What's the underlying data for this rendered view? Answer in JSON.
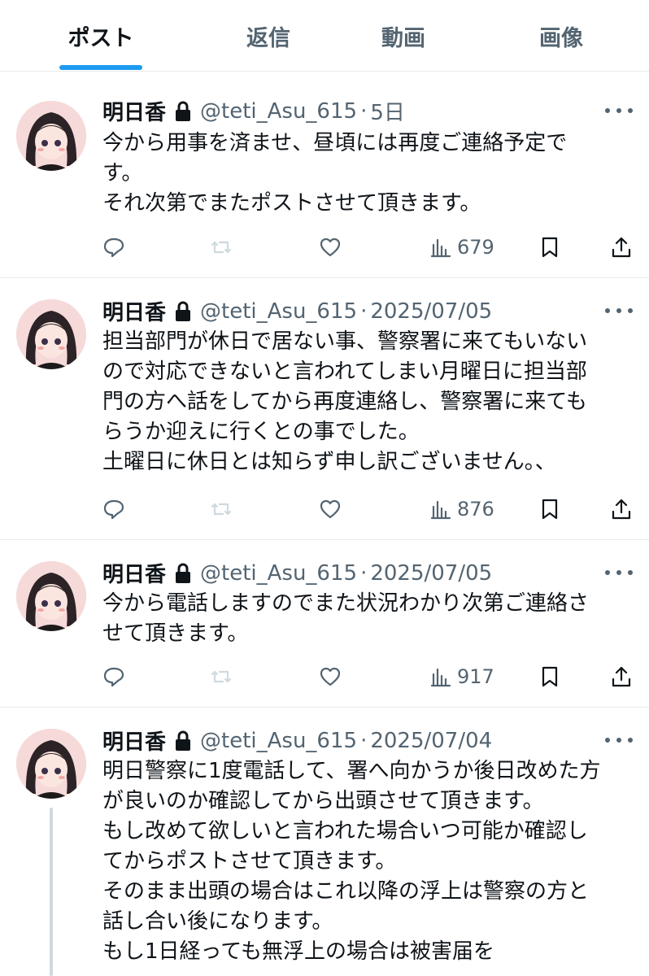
{
  "tabs": [
    {
      "label": "ポスト"
    },
    {
      "label": "返信"
    },
    {
      "label": "動画"
    },
    {
      "label": "画像"
    }
  ],
  "icons": {
    "lock": "lock-icon",
    "reply": "reply-icon",
    "repost": "repost-icon",
    "like": "like-icon",
    "views": "views-icon",
    "bookmark": "bookmark-icon",
    "share": "share-icon",
    "more": "more-icon"
  },
  "colors": {
    "accent": "#1d9bf0",
    "text": "#0f1419",
    "muted": "#536471"
  },
  "posts": [
    {
      "name": "明日香",
      "handle": "@teti_Asu_615",
      "date": "5日",
      "lines": [
        "今から用事を済ませ、昼頃には再度ご連絡予定で",
        "す。",
        "それ次第でまたポストさせて頂きます。"
      ],
      "views": "679"
    },
    {
      "name": "明日香",
      "handle": "@teti_Asu_615",
      "date": "2025/07/05",
      "lines": [
        "担当部門が休日で居ない事、警察署に来てもいない",
        "ので対応できないと言われてしまい月曜日に担当部",
        "門の方へ話をしてから再度連絡し、警察署に来ても",
        "らうか迎えに行くとの事でした。",
        "土曜日に休日とは知らず申し訳ございません。、"
      ],
      "views": "876"
    },
    {
      "name": "明日香",
      "handle": "@teti_Asu_615",
      "date": "2025/07/05",
      "lines": [
        "今から電話しますのでまた状況わかり次第ご連絡さ",
        "せて頂きます。"
      ],
      "views": "917"
    },
    {
      "name": "明日香",
      "handle": "@teti_Asu_615",
      "date": "2025/07/04",
      "lines": [
        "明日警察に1度電話して、署へ向かうか後日改めた方",
        "が良いのか確認してから出頭させて頂きます。",
        "もし改めて欲しいと言われた場合いつ可能か確認し",
        "てからポストさせて頂きます。",
        "そのまま出頭の場合はこれ以降の浮上は警察の方と",
        "話し合い後になります。",
        "もし1日経っても無浮上の場合は被害届を"
      ]
    }
  ]
}
